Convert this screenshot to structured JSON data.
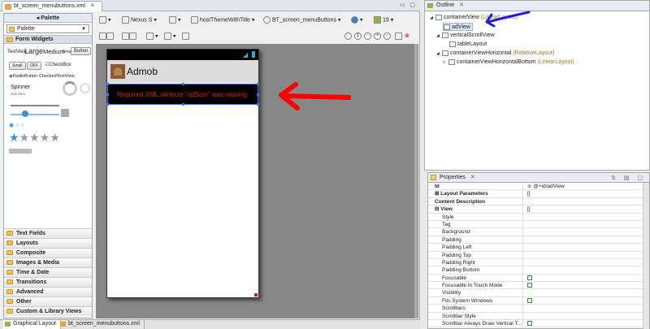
{
  "editor": {
    "file_tab": "bt_screen_menubuttons.xml",
    "bottom_tabs": [
      "Graphical Layout",
      "bt_screen_menubuttons.xml"
    ]
  },
  "palette": {
    "header": "Palette",
    "selector": "Palette",
    "open_category": "Form Widgets",
    "widgets": {
      "textviews": "TextView",
      "large": "Large",
      "medium": "Medium",
      "small": "Small",
      "button": "Button",
      "small_btn": "Small",
      "off": "OFF",
      "checkbox": "CheckBox",
      "radio": "RadioButton",
      "checked_text": "CheckedTextView",
      "spinner": "Spinner",
      "sub_item": "Sub Item"
    },
    "categories": [
      "Text Fields",
      "Layouts",
      "Composite",
      "Images & Media",
      "Time & Date",
      "Transitions",
      "Advanced",
      "Other",
      "Custom & Library Views"
    ]
  },
  "toolbar": {
    "device": "Nexus S",
    "theme": "hostThemeWithTitle",
    "activity": "BT_screen_menuButtons",
    "api": "19"
  },
  "device_preview": {
    "app_title": "Admob",
    "error_message": "Required XML attribute \"adSize\" was missing."
  },
  "outline": {
    "title": "Outline",
    "nodes": [
      {
        "name": "containerView",
        "type": "(LinearLayout)"
      },
      {
        "name": "adView",
        "type": ""
      },
      {
        "name": "verticalScrollView",
        "type": ""
      },
      {
        "name": "tableLayout",
        "type": ""
      },
      {
        "name": "containerViewHorizontal",
        "type": "(RelativeLayout)"
      },
      {
        "name": "containerViewHorizontalBottom",
        "type": "(LinearLayout)"
      }
    ]
  },
  "properties": {
    "title": "Properties",
    "rows": [
      {
        "key": "Id",
        "value": "@+id/adView",
        "kind": "top"
      },
      {
        "key": "Layout Parameters",
        "value": "[]",
        "kind": "group"
      },
      {
        "key": "Content Description",
        "value": "",
        "kind": "top"
      },
      {
        "key": "View",
        "value": "[]",
        "kind": "group"
      },
      {
        "key": "Style",
        "value": "",
        "kind": "sub"
      },
      {
        "key": "Tag",
        "value": "",
        "kind": "sub"
      },
      {
        "key": "Background",
        "value": "",
        "kind": "sub"
      },
      {
        "key": "Padding",
        "value": "",
        "kind": "sub"
      },
      {
        "key": "Padding Left",
        "value": "",
        "kind": "sub"
      },
      {
        "key": "Padding Top",
        "value": "",
        "kind": "sub"
      },
      {
        "key": "Padding Right",
        "value": "",
        "kind": "sub"
      },
      {
        "key": "Padding Bottom",
        "value": "",
        "kind": "sub"
      },
      {
        "key": "Focusable",
        "value": "",
        "kind": "check"
      },
      {
        "key": "Focusable In Touch Mode",
        "value": "",
        "kind": "check"
      },
      {
        "key": "Visibility",
        "value": "",
        "kind": "sub"
      },
      {
        "key": "Fits System Windows",
        "value": "",
        "kind": "check"
      },
      {
        "key": "Scrollbars",
        "value": "",
        "kind": "sub"
      },
      {
        "key": "Scrollbar Style",
        "value": "",
        "kind": "sub"
      },
      {
        "key": "Scrollbar Always Draw Vertical T...",
        "value": "",
        "kind": "check"
      }
    ]
  },
  "colors": {
    "selection": "#3d6cff",
    "error_text": "#e31a1a",
    "arrow_red": "#ff0000",
    "arrow_blue": "#1f1fd6"
  }
}
